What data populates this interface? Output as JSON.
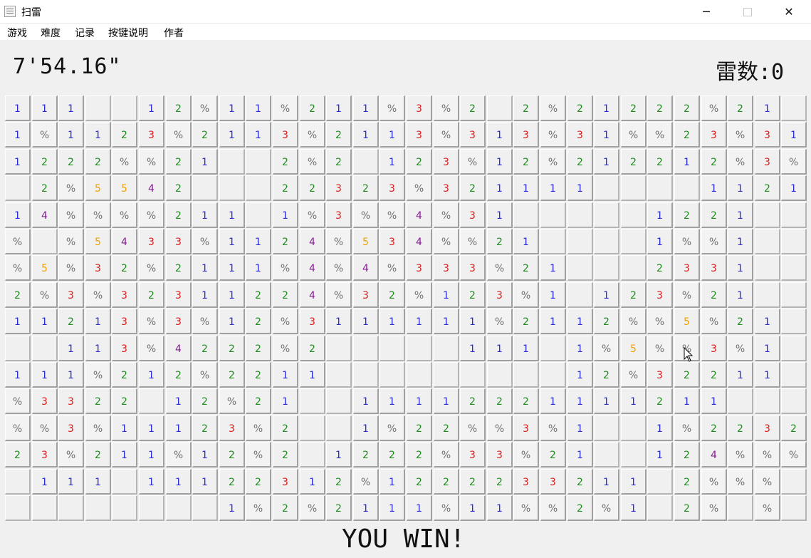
{
  "window": {
    "title": "扫雷",
    "minimize": "─",
    "close": "✕",
    "icon": "minesweeper-app-icon"
  },
  "menu": {
    "items": [
      "游戏",
      "难度",
      "记录",
      "按键说明",
      "作者"
    ]
  },
  "header": {
    "timer": "7'54.16\"",
    "mine_count": "雷数:0"
  },
  "board": {
    "rows": 16,
    "cols": 30,
    "mine_symbol": "%",
    "number_colors": {
      "1": "#2b2bd6",
      "2": "#1e8c1e",
      "3": "#dc1c1c",
      "4": "#8b1a9a",
      "5": "#f0a000"
    },
    "grid": [
      [
        "1",
        "1",
        "1",
        "",
        "",
        "1",
        "2",
        "%",
        "1",
        "1",
        "%",
        "2",
        "1",
        "1",
        "%",
        "3",
        "%",
        "2",
        "",
        "2",
        "%",
        "2",
        "1",
        "2",
        "2",
        "2",
        "%",
        "2",
        "1",
        ""
      ],
      [
        "1",
        "%",
        "1",
        "1",
        "2",
        "3",
        "%",
        "2",
        "1",
        "1",
        "3",
        "%",
        "2",
        "1",
        "1",
        "3",
        "%",
        "3",
        "1",
        "3",
        "%",
        "3",
        "1",
        "%",
        "%",
        "2",
        "3",
        "%",
        "3",
        "1"
      ],
      [
        "1",
        "2",
        "2",
        "2",
        "%",
        "%",
        "2",
        "1",
        "",
        "",
        "2",
        "%",
        "2",
        "",
        "1",
        "2",
        "3",
        "%",
        "1",
        "2",
        "%",
        "2",
        "1",
        "2",
        "2",
        "1",
        "2",
        "%",
        "3",
        "%"
      ],
      [
        "",
        "2",
        "%",
        "5",
        "5",
        "4",
        "2",
        "",
        "",
        "",
        "2",
        "2",
        "3",
        "2",
        "3",
        "%",
        "3",
        "2",
        "1",
        "1",
        "1",
        "1",
        "",
        "",
        "",
        "",
        "1",
        "1",
        "2",
        "1"
      ],
      [
        "1",
        "4",
        "%",
        "%",
        "%",
        "%",
        "2",
        "1",
        "1",
        "",
        "1",
        "%",
        "3",
        "%",
        "%",
        "4",
        "%",
        "3",
        "1",
        "",
        "",
        "",
        "",
        "",
        "1",
        "2",
        "2",
        "1",
        "",
        ""
      ],
      [
        "%",
        "",
        "%",
        "5",
        "4",
        "3",
        "3",
        "%",
        "1",
        "1",
        "2",
        "4",
        "%",
        "5",
        "3",
        "4",
        "%",
        "%",
        "2",
        "1",
        "",
        "",
        "",
        "",
        "1",
        "%",
        "%",
        "1",
        "",
        ""
      ],
      [
        "%",
        "5",
        "%",
        "3",
        "2",
        "%",
        "2",
        "1",
        "1",
        "1",
        "%",
        "4",
        "%",
        "4",
        "%",
        "3",
        "3",
        "3",
        "%",
        "2",
        "1",
        "",
        "",
        "",
        "2",
        "3",
        "3",
        "1",
        "",
        ""
      ],
      [
        "2",
        "%",
        "3",
        "%",
        "3",
        "2",
        "3",
        "1",
        "1",
        "2",
        "2",
        "4",
        "%",
        "3",
        "2",
        "%",
        "1",
        "2",
        "3",
        "%",
        "1",
        "",
        "1",
        "2",
        "3",
        "%",
        "2",
        "1",
        "",
        ""
      ],
      [
        "1",
        "1",
        "2",
        "1",
        "3",
        "%",
        "3",
        "%",
        "1",
        "2",
        "%",
        "3",
        "1",
        "1",
        "1",
        "1",
        "1",
        "1",
        "%",
        "2",
        "1",
        "1",
        "2",
        "%",
        "%",
        "5",
        "%",
        "2",
        "1",
        ""
      ],
      [
        "",
        "",
        "1",
        "1",
        "3",
        "%",
        "4",
        "2",
        "2",
        "2",
        "%",
        "2",
        "",
        "",
        "",
        "",
        "",
        "1",
        "1",
        "1",
        "",
        "1",
        "%",
        "5",
        "%",
        "%",
        "3",
        "%",
        "1",
        ""
      ],
      [
        "1",
        "1",
        "1",
        "%",
        "2",
        "1",
        "2",
        "%",
        "2",
        "2",
        "1",
        "1",
        "",
        "",
        "",
        "",
        "",
        "",
        "",
        "",
        "",
        "1",
        "2",
        "%",
        "3",
        "2",
        "2",
        "1",
        "1",
        ""
      ],
      [
        "%",
        "3",
        "3",
        "2",
        "2",
        "",
        "1",
        "2",
        "%",
        "2",
        "1",
        "",
        "",
        "1",
        "1",
        "1",
        "1",
        "2",
        "2",
        "2",
        "1",
        "1",
        "1",
        "1",
        "2",
        "1",
        "1",
        "",
        "",
        ""
      ],
      [
        "%",
        "%",
        "3",
        "%",
        "1",
        "1",
        "1",
        "2",
        "3",
        "%",
        "2",
        "",
        "",
        "1",
        "%",
        "2",
        "2",
        "%",
        "%",
        "3",
        "%",
        "1",
        "",
        "",
        "1",
        "%",
        "2",
        "2",
        "3",
        "2"
      ],
      [
        "2",
        "3",
        "%",
        "2",
        "1",
        "1",
        "%",
        "1",
        "2",
        "%",
        "2",
        "",
        "1",
        "2",
        "2",
        "2",
        "%",
        "3",
        "3",
        "%",
        "2",
        "1",
        "",
        "",
        "1",
        "2",
        "4",
        "%",
        "%",
        "%"
      ],
      [
        "",
        "1",
        "1",
        "1",
        "",
        "1",
        "1",
        "1",
        "2",
        "2",
        "3",
        "1",
        "2",
        "%",
        "1",
        "2",
        "2",
        "2",
        "2",
        "3",
        "3",
        "2",
        "1",
        "1",
        "",
        "2",
        "%",
        "%",
        "%",
        ""
      ],
      [
        "",
        "",
        "",
        "",
        "",
        "",
        "",
        "",
        "1",
        "%",
        "2",
        "%",
        "2",
        "1",
        "1",
        "1",
        "%",
        "1",
        "1",
        "%",
        "%",
        "2",
        "%",
        "1",
        "",
        "2",
        "%",
        "",
        "%",
        ""
      ]
    ]
  },
  "status": {
    "message": "YOU WIN!"
  }
}
